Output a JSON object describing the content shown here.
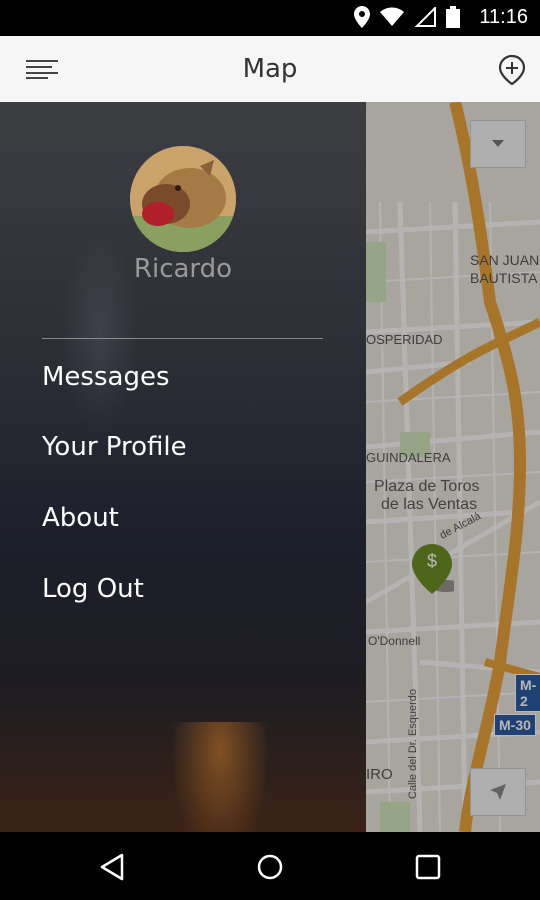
{
  "status_bar": {
    "time": "11:16",
    "icons": [
      "location-icon",
      "wifi-icon",
      "signal-icon",
      "battery-icon"
    ]
  },
  "app_bar": {
    "title": "Map",
    "left_icon": "menu-icon",
    "right_icon": "add-location-icon"
  },
  "drawer": {
    "user_name": "Ricardo",
    "menu": [
      {
        "label": "Messages"
      },
      {
        "label": "Your Profile"
      },
      {
        "label": "About"
      },
      {
        "label": "Log Out"
      }
    ]
  },
  "map": {
    "labels": {
      "san_juan": "SAN JUAN",
      "bautista": "BAUTISTA",
      "prosperidad": "OSPERIDAD",
      "guindalera": "GUINDALERA",
      "plaza_line1": "Plaza de Toros",
      "plaza_line2": "de las Ventas",
      "alcala": "de Alcalá",
      "odonnell": "O'Donnell",
      "esquerdo": "Calle del Dr. Esquerdo",
      "m2": "M-2",
      "m30": "M-30",
      "iro": "IRO"
    },
    "marker_symbol": "$"
  },
  "nav_bar": {
    "icons": [
      "back-icon",
      "home-icon",
      "recents-icon"
    ]
  },
  "colors": {
    "appbar_bg": "#f6f6f6",
    "map_bg": "#e9e5dc",
    "highway": "#e8a33a",
    "marker": "#6b8e23"
  }
}
